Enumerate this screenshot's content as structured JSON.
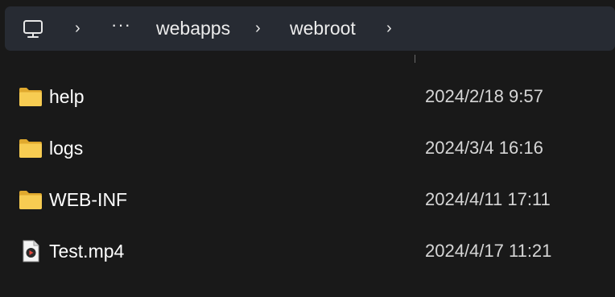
{
  "breadcrumb": {
    "computer_icon": "monitor-icon",
    "separator_1": "›",
    "overflow": "···",
    "item_1": "webapps",
    "separator_2": "›",
    "item_2": "webroot",
    "separator_3": "›"
  },
  "files": [
    {
      "name": "help",
      "date": "2024/2/18 9:57",
      "type": "folder",
      "icon": "folder-icon"
    },
    {
      "name": "logs",
      "date": "2024/3/4 16:16",
      "type": "folder",
      "icon": "folder-icon"
    },
    {
      "name": "WEB-INF",
      "date": "2024/4/11 17:11",
      "type": "folder",
      "icon": "folder-icon"
    },
    {
      "name": "Test.mp4",
      "date": "2024/4/17 11:21",
      "type": "video",
      "icon": "video-file-icon"
    }
  ],
  "colors": {
    "background": "#191919",
    "addressbar": "#272b33",
    "folder": "#f5c84a"
  }
}
